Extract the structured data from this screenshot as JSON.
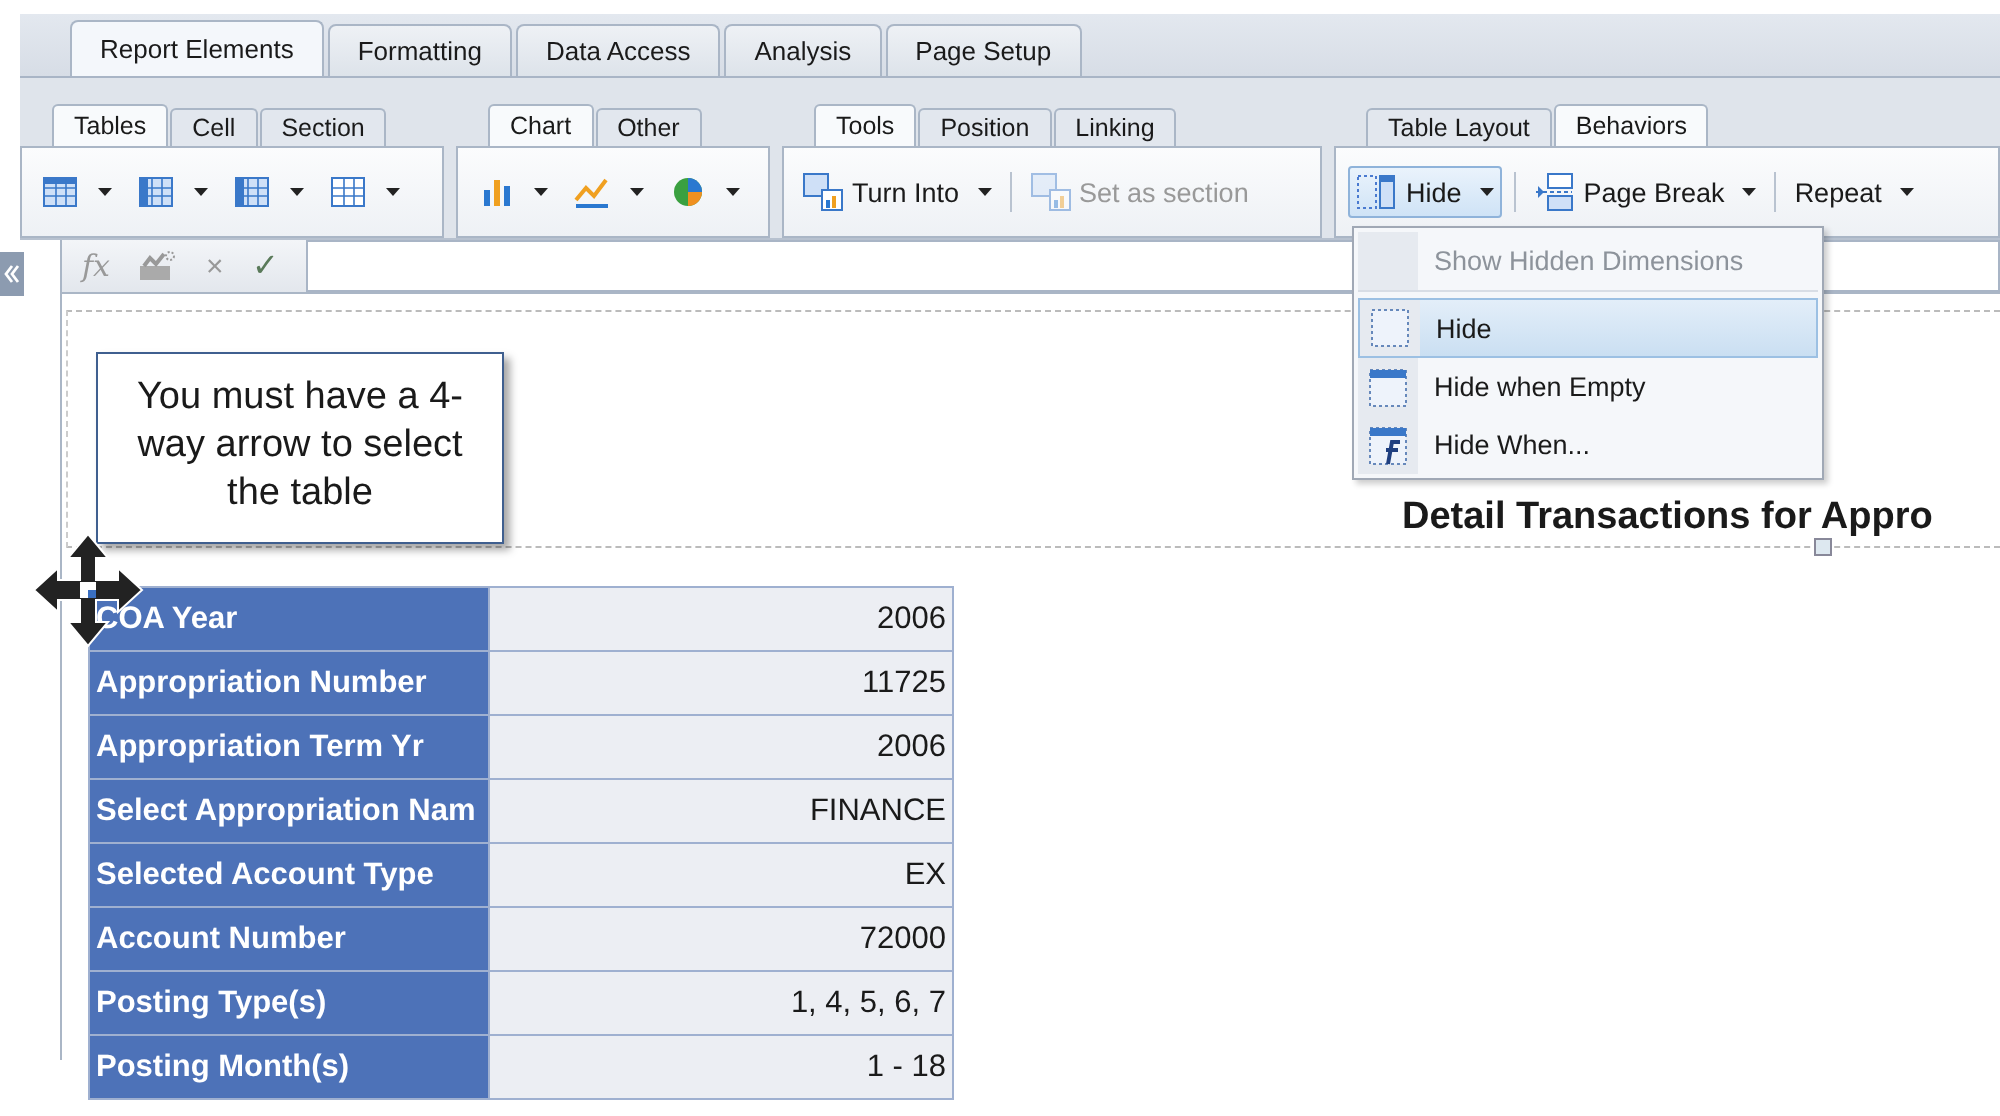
{
  "main_tabs": [
    {
      "label": "Report Elements",
      "selected": true
    },
    {
      "label": "Formatting",
      "selected": false
    },
    {
      "label": "Data Access",
      "selected": false
    },
    {
      "label": "Analysis",
      "selected": false
    },
    {
      "label": "Page Setup",
      "selected": false
    }
  ],
  "ribbon_groups": [
    {
      "tabs": [
        {
          "label": "Tables",
          "selected": true
        },
        {
          "label": "Cell",
          "selected": false
        },
        {
          "label": "Section",
          "selected": false
        }
      ],
      "tools": [
        {
          "kind": "icon_menu"
        },
        {
          "kind": "icon_menu"
        },
        {
          "kind": "icon_menu"
        },
        {
          "kind": "icon_menu"
        }
      ]
    },
    {
      "tabs": [
        {
          "label": "Chart",
          "selected": true
        },
        {
          "label": "Other",
          "selected": false
        }
      ],
      "tools": [
        {
          "kind": "icon_menu"
        },
        {
          "kind": "icon_menu"
        },
        {
          "kind": "icon_menu"
        }
      ]
    },
    {
      "tabs": [
        {
          "label": "Tools",
          "selected": true
        },
        {
          "label": "Position",
          "selected": false
        },
        {
          "label": "Linking",
          "selected": false
        }
      ],
      "tools": [
        {
          "kind": "menu_button",
          "label": "Turn Into",
          "disabled": false,
          "pressed": false
        },
        {
          "kind": "button",
          "label": "Set as section",
          "disabled": true,
          "pressed": false
        }
      ]
    },
    {
      "tabs": [
        {
          "label": "Table Layout",
          "selected": false
        },
        {
          "label": "Behaviors",
          "selected": true
        }
      ],
      "tools": [
        {
          "kind": "menu_button",
          "label": "Hide",
          "disabled": false,
          "pressed": true
        },
        {
          "kind": "menu_button",
          "label": "Page Break",
          "disabled": false,
          "pressed": false
        },
        {
          "kind": "menu_button",
          "label": "Repeat",
          "disabled": false,
          "pressed": false
        }
      ]
    }
  ],
  "formula_bar": {
    "buttons": [
      {
        "kind": "text",
        "label": "fx"
      },
      {
        "kind": "icon"
      },
      {
        "kind": "text",
        "label": "×"
      },
      {
        "kind": "text",
        "label": "✓"
      }
    ]
  },
  "hide_menu": [
    {
      "label": "Show Hidden Dimensions",
      "disabled": true,
      "selected": false
    },
    {
      "label": "Hide",
      "disabled": false,
      "selected": true
    },
    {
      "label": "Hide when Empty",
      "disabled": false,
      "selected": false
    },
    {
      "label": "Hide When...",
      "disabled": false,
      "selected": false
    }
  ],
  "callout": "You must have a 4-way arrow to select the table",
  "report_title": "Detail Transactions for Appro",
  "table": {
    "rows": [
      {
        "label": "COA Year",
        "value": "2006"
      },
      {
        "label": "Appropriation Number",
        "value": "11725"
      },
      {
        "label": "Appropriation Term Yr",
        "value": "2006"
      },
      {
        "label": "Select Appropriation Nam",
        "value": "FINANCE"
      },
      {
        "label": "Selected Account Type",
        "value": "EX"
      },
      {
        "label": "Account Number",
        "value": "72000"
      },
      {
        "label": "Posting Type(s)",
        "value": "1, 4, 5, 6, 7"
      },
      {
        "label": "Posting Month(s)",
        "value": "1 - 18"
      }
    ]
  }
}
